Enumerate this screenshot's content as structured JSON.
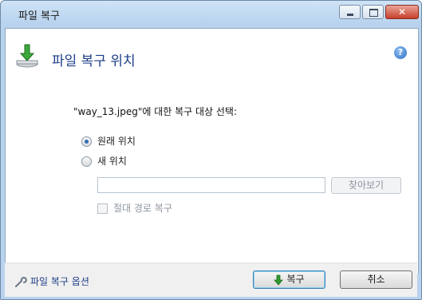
{
  "window": {
    "title": "파일 복구"
  },
  "header": {
    "title": "파일 복구 위치"
  },
  "prompt": "\"way_13.jpeg\"에 대한 복구 대상 선택:",
  "options": {
    "original": {
      "label": "원래 위치",
      "checked": true
    },
    "new": {
      "label": "새 위치",
      "checked": false
    }
  },
  "path_input": {
    "value": "",
    "placeholder": ""
  },
  "browse_label": "찾아보기",
  "absolute_path_label": "절대 경로 복구",
  "footer": {
    "options_link": "파일 복구 옵션",
    "recover_label": "복구",
    "cancel_label": "취소"
  },
  "colors": {
    "accent": "#1f3e88",
    "arrow_green": "#2e9a2e",
    "title_bar": "#b9d3ee",
    "close_red": "#c7402c"
  }
}
